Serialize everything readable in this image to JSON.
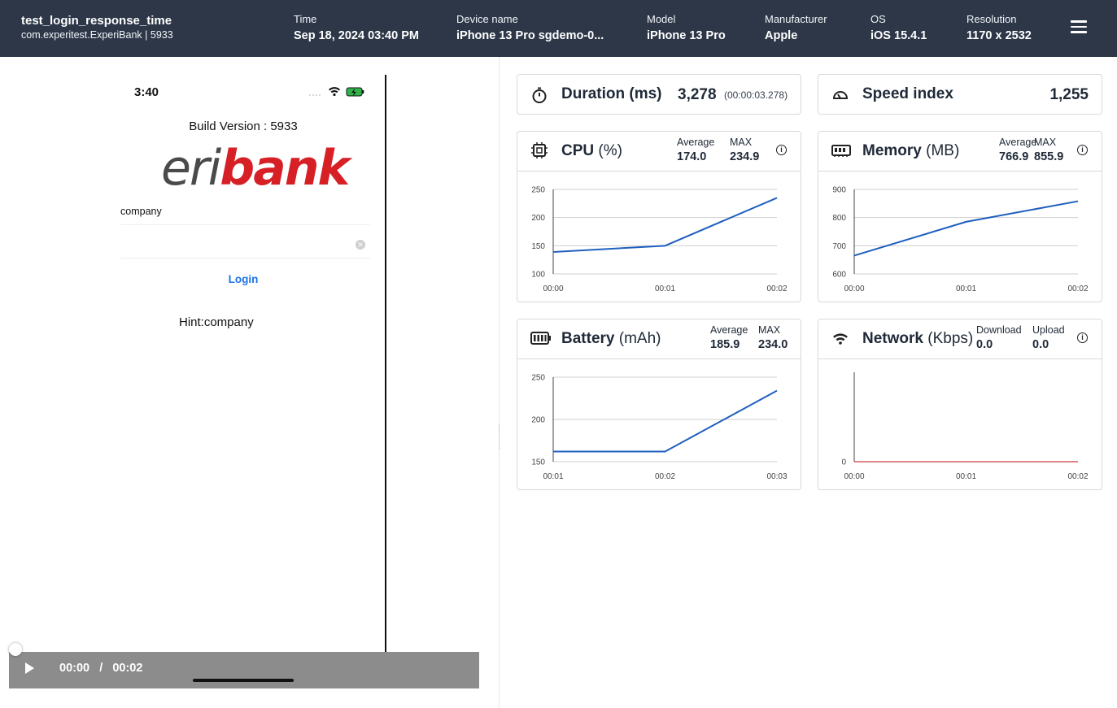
{
  "header": {
    "test_name": "test_login_response_time",
    "test_sub": "com.experitest.ExperiBank | 5933",
    "fields": [
      {
        "label": "Time",
        "value": "Sep 18, 2024 03:40 PM"
      },
      {
        "label": "Device name",
        "value": "iPhone 13 Pro sgdemo-0..."
      },
      {
        "label": "Model",
        "value": "iPhone 13 Pro"
      },
      {
        "label": "Manufacturer",
        "value": "Apple"
      },
      {
        "label": "OS",
        "value": "iOS 15.4.1"
      },
      {
        "label": "Resolution",
        "value": "1170 x 2532"
      }
    ],
    "menu_icon": "hamburger-menu-icon"
  },
  "phone": {
    "time": "3:40",
    "build_version": "Build Version : 5933",
    "logo_eri": "eri",
    "logo_bank": "bank",
    "username_value": "company",
    "password_value": "",
    "login_label": "Login",
    "hint": "Hint:company"
  },
  "player": {
    "current": "00:00",
    "separator": "/",
    "total": "00:02"
  },
  "duration": {
    "title": "Duration",
    "unit": "(ms)",
    "value": "3,278",
    "detail": "(00:00:03.278)",
    "icon": "stopwatch-icon"
  },
  "speed_index": {
    "title": "Speed index",
    "value": "1,255",
    "icon": "speedometer-icon"
  },
  "cpu": {
    "title": "CPU",
    "unit": "(%)",
    "avg_label": "Average",
    "avg": "174.0",
    "max_label": "MAX",
    "max": "234.9",
    "icon": "chip-icon"
  },
  "memory": {
    "title": "Memory",
    "unit": "(MB)",
    "avg_label": "Average",
    "avg": "766.9",
    "max_label": "MAX",
    "max": "855.9",
    "icon": "memory-icon"
  },
  "battery": {
    "title": "Battery",
    "unit": "(mAh)",
    "avg_label": "Average",
    "avg": "185.9",
    "max_label": "MAX",
    "max": "234.0",
    "icon": "battery-icon"
  },
  "network": {
    "title": "Network",
    "unit": "(Kbps)",
    "dl_label": "Download",
    "dl": "0.0",
    "ul_label": "Upload",
    "ul": "0.0",
    "icon": "wifi-icon"
  },
  "colors": {
    "header_bg": "#2d3748",
    "series": "#1f5fbf",
    "network_series": "#d13a3a",
    "login": "#1a73e8",
    "logo_red": "#d71f26"
  },
  "chart_data": [
    {
      "id": "cpu",
      "type": "line",
      "x": [
        "00:00",
        "00:01",
        "00:02"
      ],
      "y": [
        139,
        150,
        235
      ],
      "yticks": [
        100,
        150,
        200,
        250
      ],
      "ylim": [
        100,
        250
      ],
      "xlabel": "",
      "ylabel": ""
    },
    {
      "id": "memory",
      "type": "line",
      "x": [
        "00:00",
        "00:01",
        "00:02"
      ],
      "y": [
        665,
        785,
        858
      ],
      "yticks": [
        600,
        700,
        800,
        900
      ],
      "ylim": [
        600,
        900
      ],
      "xlabel": "",
      "ylabel": ""
    },
    {
      "id": "battery",
      "type": "line",
      "x": [
        "00:01",
        "00:02",
        "00:03"
      ],
      "y": [
        162,
        162,
        234
      ],
      "yticks": [
        150,
        200,
        250
      ],
      "ylim": [
        150,
        250
      ],
      "xlabel": "",
      "ylabel": ""
    },
    {
      "id": "network",
      "type": "line",
      "x": [
        "00:00",
        "00:01",
        "00:02"
      ],
      "y": [
        0,
        0,
        0
      ],
      "yticks": [
        0
      ],
      "ylim": [
        0,
        1
      ],
      "xlabel": "",
      "ylabel": ""
    }
  ]
}
